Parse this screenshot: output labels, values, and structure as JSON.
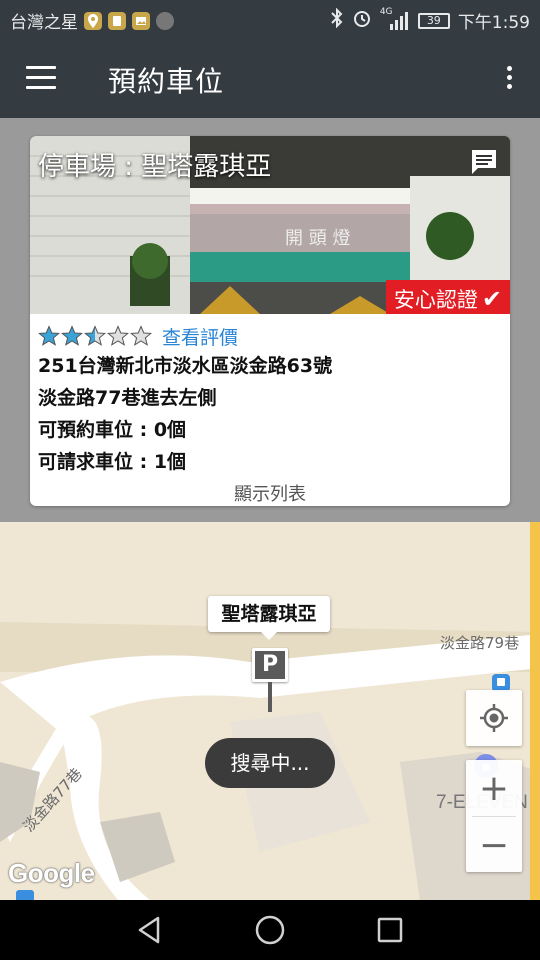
{
  "status_bar": {
    "carrier": "台灣之星",
    "network": "4G",
    "battery": "39",
    "time": "下午1:59"
  },
  "toolbar": {
    "title": "預約車位"
  },
  "card": {
    "header": "停車場 : 聖塔露琪亞",
    "photo_sign": "開 頭 燈",
    "badge": "安心認證",
    "rating": 2.5,
    "rating_max": 5,
    "review_link": "查看評價",
    "address": "251台灣新北市淡水區淡金路63號",
    "directions": "淡金路77巷進去左側",
    "reservable": "可預約車位 : 0個",
    "requestable": "可請求車位 : 1個",
    "show_list": "顯示列表"
  },
  "map": {
    "place_label": "聖塔露琪亞",
    "pin_letter": "P",
    "road_79": "淡金路79巷",
    "road_77": "淡金路77巷",
    "store": "7-ELEVEN",
    "searching": "搜尋中...",
    "zoom_in": "+",
    "zoom_out": "−",
    "google": "Google"
  },
  "colors": {
    "toolbar_bg": "#343b41",
    "badge_red": "#e31d24",
    "link_blue": "#2a84d6",
    "star_blue": "#3aa3d8"
  }
}
